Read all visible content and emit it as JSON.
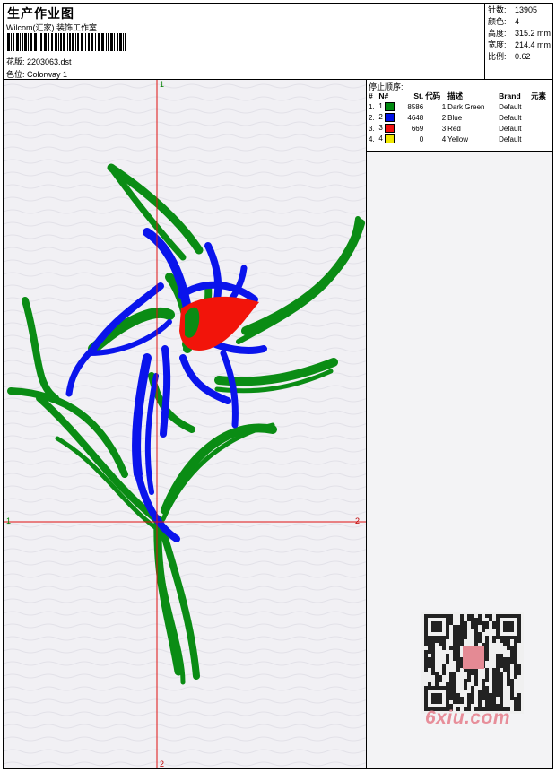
{
  "header": {
    "title": "生产作业图",
    "company": "Wilcom(汇家) 装饰工作室",
    "design_file": "花版: 2203063.dst",
    "colorway": "色位:  Colorway 1"
  },
  "stats": [
    {
      "label": "针数:",
      "value": "13905"
    },
    {
      "label": "颜色:",
      "value": "4"
    },
    {
      "label": "高度:",
      "value": "315.2 mm"
    },
    {
      "label": "宽度:",
      "value": "214.4 mm"
    },
    {
      "label": "比例:",
      "value": "0.62"
    }
  ],
  "stop_sequence": {
    "title": "停止顺序:",
    "columns": [
      "#",
      "N#",
      "St.",
      "代码",
      "描述",
      "Brand",
      "元素"
    ],
    "rows": [
      {
        "num": "1.",
        "n": "1",
        "color": "#008a10",
        "stitches": "8586",
        "code": "1",
        "desc": "Dark Green",
        "brand": "Default"
      },
      {
        "num": "2.",
        "n": "2",
        "color": "#0010e8",
        "stitches": "4648",
        "code": "2",
        "desc": "Blue",
        "brand": "Default"
      },
      {
        "num": "3.",
        "n": "3",
        "color": "#f01010",
        "stitches": "669",
        "code": "3",
        "desc": "Red",
        "brand": "Default"
      },
      {
        "num": "4.",
        "n": "4",
        "color": "#f0e800",
        "stitches": "0",
        "code": "4",
        "desc": "Yellow",
        "brand": "Default"
      }
    ]
  },
  "axis_labels": {
    "top": "1",
    "left": "1",
    "right": "2",
    "bottom": "2"
  },
  "colors": {
    "green": "#0a8c14",
    "blue": "#0a14ec",
    "red": "#f2140a",
    "crosshair": "#e01010"
  },
  "watermark": "6xiu.com"
}
